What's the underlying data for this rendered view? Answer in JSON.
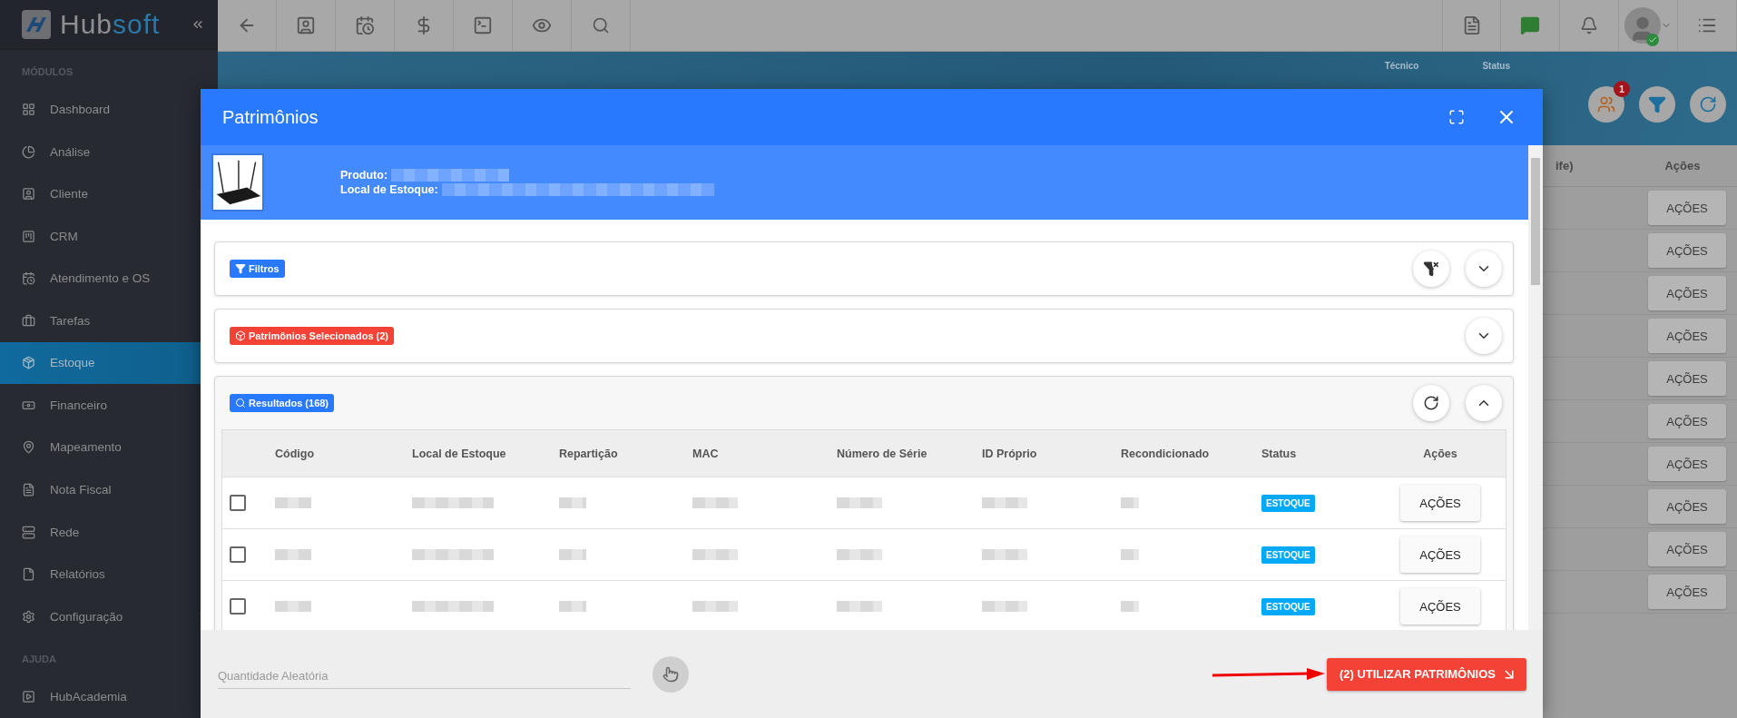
{
  "sidebar": {
    "logo": {
      "part_1": "Hub",
      "part_2": "soft"
    },
    "sections": [
      {
        "title": "MÓDULOS",
        "items": [
          {
            "label": "Dashboard",
            "selected": false,
            "has_submenu": false
          },
          {
            "label": "Análise",
            "selected": false,
            "has_submenu": false
          },
          {
            "label": "Cliente",
            "selected": false,
            "has_submenu": true
          },
          {
            "label": "CRM",
            "selected": false,
            "has_submenu": false
          },
          {
            "label": "Atendimento e OS",
            "selected": false,
            "has_submenu": false
          },
          {
            "label": "Tarefas",
            "selected": false,
            "has_submenu": false
          },
          {
            "label": "Estoque",
            "selected": true,
            "has_submenu": false
          },
          {
            "label": "Financeiro",
            "selected": false,
            "has_submenu": false
          },
          {
            "label": "Mapeamento",
            "selected": false,
            "has_submenu": false
          },
          {
            "label": "Nota Fiscal",
            "selected": false,
            "has_submenu": false
          },
          {
            "label": "Rede",
            "selected": false,
            "has_submenu": false
          },
          {
            "label": "Relatórios",
            "selected": false,
            "has_submenu": false
          },
          {
            "label": "Configuração",
            "selected": false,
            "has_submenu": true
          }
        ]
      },
      {
        "title": "AJUDA",
        "items": [
          {
            "label": "HubAcademia",
            "selected": false,
            "has_submenu": false
          }
        ]
      }
    ]
  },
  "page": {
    "filters": [
      "Técnico",
      "Status"
    ],
    "badge": "1",
    "table": {
      "columns": [
        "ife)",
        "Ações"
      ],
      "row_actions": [
        "AÇÕES",
        "AÇÕES",
        "AÇÕES",
        "AÇÕES",
        "AÇÕES",
        "AÇÕES",
        "AÇÕES",
        "AÇÕES",
        "AÇÕES",
        "AÇÕES"
      ]
    }
  },
  "modal": {
    "title": "Patrimônios",
    "product": {
      "fields": [
        "Produto:",
        "Local de Estoque:"
      ]
    },
    "sections": [
      {
        "kind": "filters",
        "label": "Filtros",
        "color": "#2979ff",
        "expanded": false
      },
      {
        "kind": "selected",
        "label": "Patrimônios Selecionados (2)",
        "color": "#f44336",
        "expanded": false
      },
      {
        "kind": "results",
        "label": "Resultados (168)",
        "color": "#2979ff",
        "expanded": true
      }
    ],
    "table": {
      "columns": [
        "Código",
        "Local de Estoque",
        "Repartição",
        "MAC",
        "Número de Série",
        "ID Próprio",
        "Recondicionado",
        "Status",
        "Ações"
      ],
      "rows": [
        {
          "checked": false,
          "status": "ESTOQUE",
          "action": "AÇÕES"
        },
        {
          "checked": false,
          "status": "ESTOQUE",
          "action": "AÇÕES"
        },
        {
          "checked": false,
          "status": "ESTOQUE",
          "action": "AÇÕES"
        }
      ]
    },
    "footer": {
      "placeholder": "Quantidade Aleatória",
      "submit": "(2) UTILIZAR PATRIMÔNIOS"
    }
  }
}
